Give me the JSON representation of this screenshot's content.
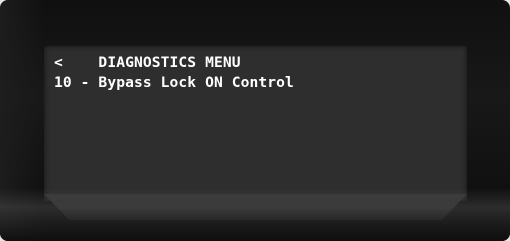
{
  "display": {
    "line1": "<    DIAGNOSTICS MENU",
    "line2": "10 - Bypass Lock ON Control"
  }
}
